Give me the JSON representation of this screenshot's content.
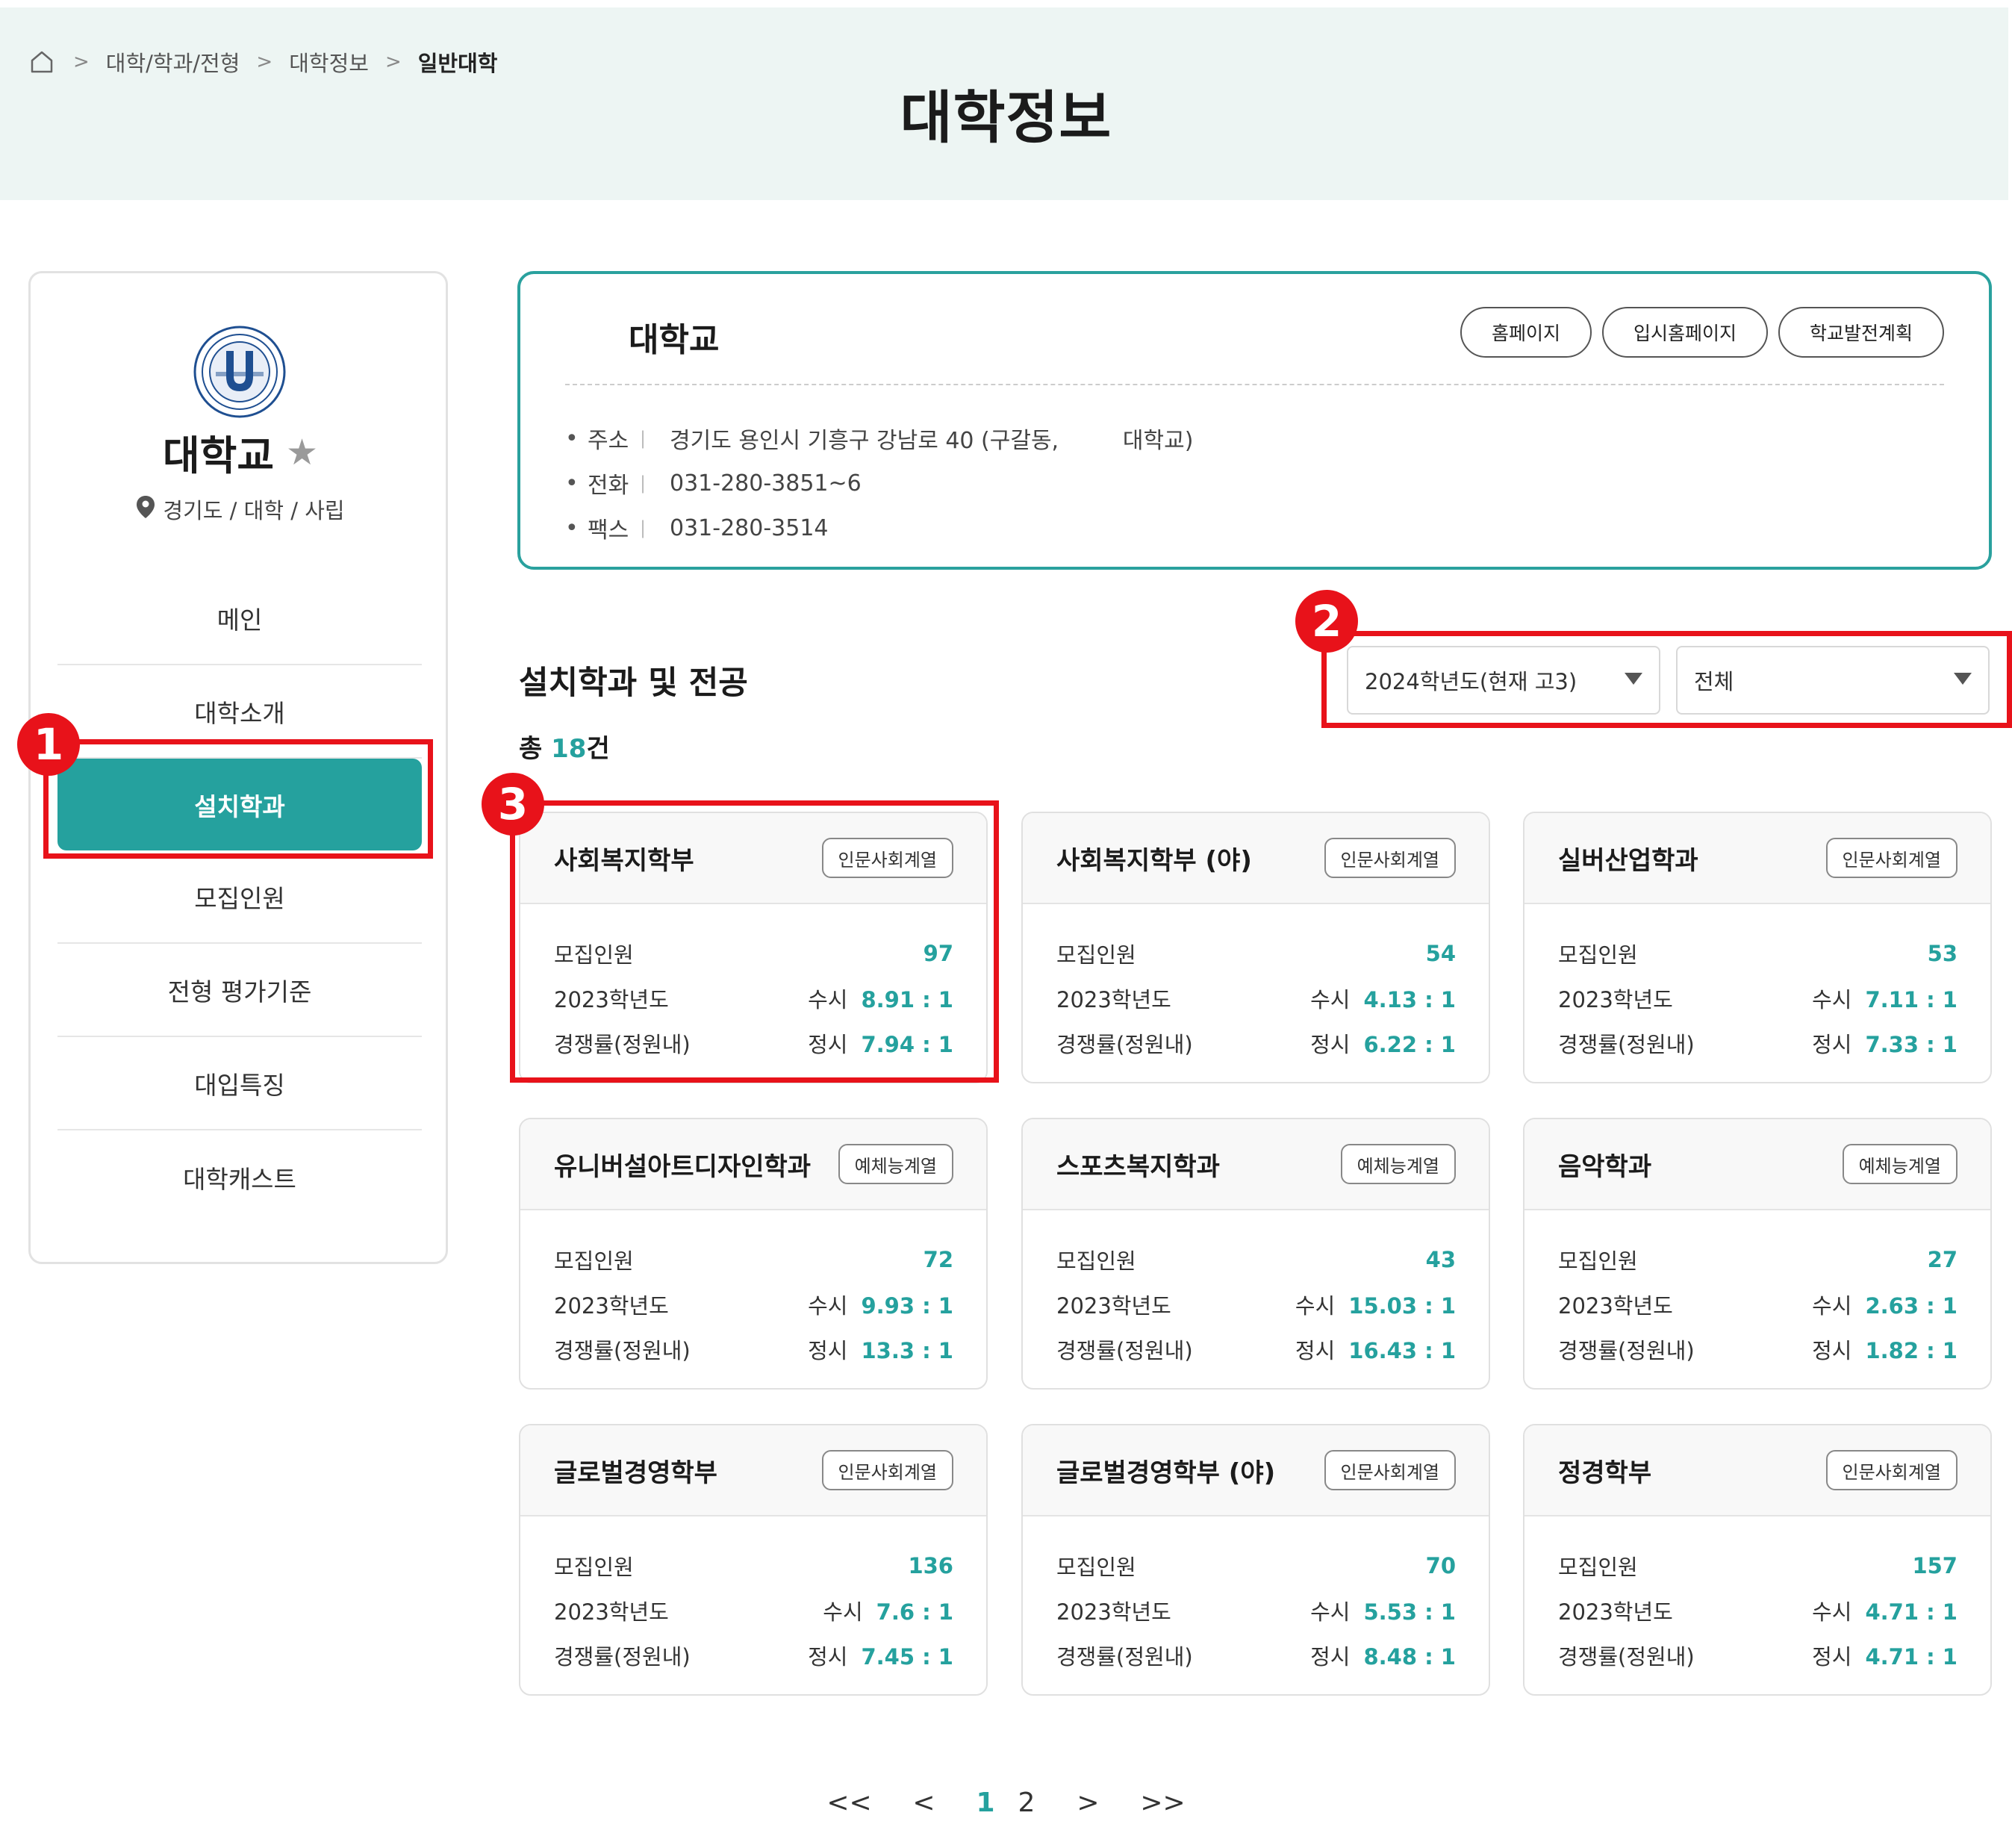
{
  "breadcrumb": {
    "items": [
      "대학/학과/전형",
      "대학정보"
    ],
    "current": "일반대학"
  },
  "page_title": "대학정보",
  "sidebar": {
    "university_name": "대학교",
    "meta": "경기도 / 대학 / 사립",
    "nav": [
      "메인",
      "대학소개",
      "설치학과",
      "모집인원",
      "전형 평가기준",
      "대입특징",
      "대학캐스트"
    ],
    "active_index": 2
  },
  "info": {
    "title": "대학교",
    "buttons": [
      "홈페이지",
      "입시홈페이지",
      "학교발전계획"
    ],
    "rows": [
      {
        "label": "주소",
        "value": "경기도 용인시 기흥구 강남로 40 (구갈동,         대학교)"
      },
      {
        "label": "전화",
        "value": "031-280-3851~6"
      },
      {
        "label": "팩스",
        "value": "031-280-3514"
      }
    ]
  },
  "section": {
    "title": "설치학과 및 전공",
    "total_prefix": "총 ",
    "total_count": "18",
    "total_suffix": "건"
  },
  "filters": {
    "year": "2024학년도(현재 고3)",
    "category": "전체"
  },
  "card_labels": {
    "recruit": "모집인원",
    "year": "2023학년도",
    "rate": "경쟁률(정원내)",
    "susi": "수시",
    "jeongsi": "정시"
  },
  "cards": [
    {
      "name": "사회복지학부",
      "tag": "인문사회계열",
      "recruit": "97",
      "susi": "8.91 : 1",
      "jeongsi": "7.94 : 1"
    },
    {
      "name": "사회복지학부 (야)",
      "tag": "인문사회계열",
      "recruit": "54",
      "susi": "4.13 : 1",
      "jeongsi": "6.22 : 1"
    },
    {
      "name": "실버산업학과",
      "tag": "인문사회계열",
      "recruit": "53",
      "susi": "7.11 : 1",
      "jeongsi": "7.33 : 1"
    },
    {
      "name": "유니버설아트디자인학과",
      "tag": "예체능계열",
      "recruit": "72",
      "susi": "9.93 : 1",
      "jeongsi": "13.3 : 1"
    },
    {
      "name": "스포츠복지학과",
      "tag": "예체능계열",
      "recruit": "43",
      "susi": "15.03 : 1",
      "jeongsi": "16.43 : 1"
    },
    {
      "name": "음악학과",
      "tag": "예체능계열",
      "recruit": "27",
      "susi": "2.63 : 1",
      "jeongsi": "1.82 : 1"
    },
    {
      "name": "글로벌경영학부",
      "tag": "인문사회계열",
      "recruit": "136",
      "susi": "7.6 : 1",
      "jeongsi": "7.45 : 1"
    },
    {
      "name": "글로벌경영학부 (야)",
      "tag": "인문사회계열",
      "recruit": "70",
      "susi": "5.53 : 1",
      "jeongsi": "8.48 : 1"
    },
    {
      "name": "정경학부",
      "tag": "인문사회계열",
      "recruit": "157",
      "susi": "4.71 : 1",
      "jeongsi": "4.71 : 1"
    }
  ],
  "pagination": {
    "pages": [
      "1",
      "2"
    ],
    "current": "1",
    "first": "<<",
    "prev": "<",
    "next": ">",
    "last": ">>"
  },
  "annotations": [
    "1",
    "2",
    "3"
  ],
  "colors": {
    "accent": "#25a19e",
    "annotation": "#e8121a",
    "header_bg": "#edf5f3"
  }
}
